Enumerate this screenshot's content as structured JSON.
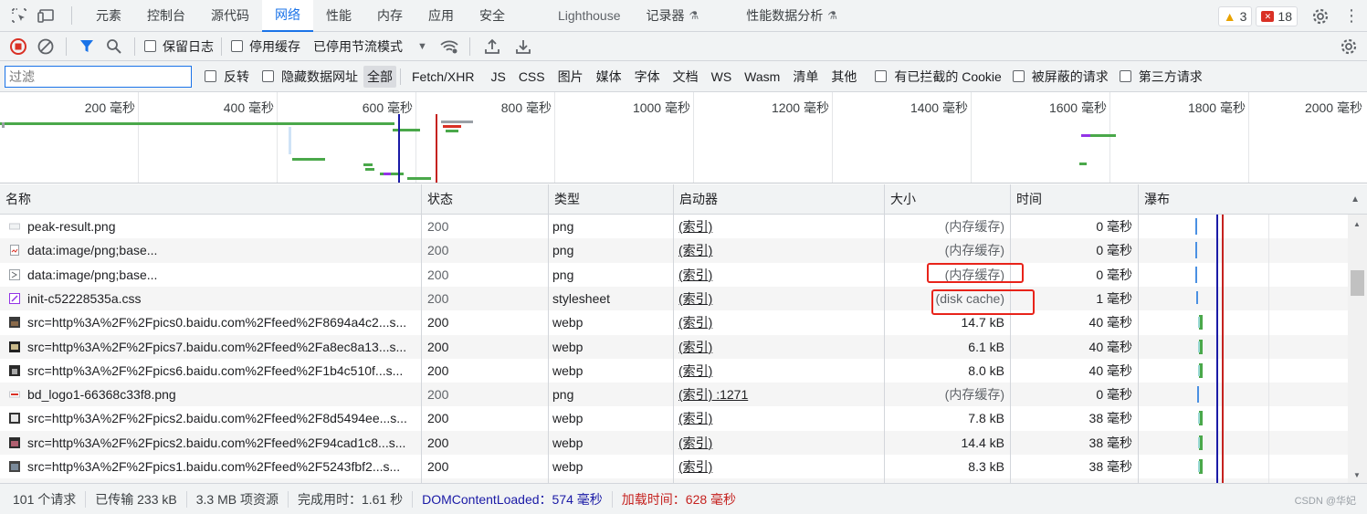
{
  "tabs": [
    {
      "label": "元素",
      "active": false
    },
    {
      "label": "控制台",
      "active": false
    },
    {
      "label": "源代码",
      "active": false
    },
    {
      "label": "网络",
      "active": true
    },
    {
      "label": "性能",
      "active": false
    },
    {
      "label": "内存",
      "active": false
    },
    {
      "label": "应用",
      "active": false
    },
    {
      "label": "安全",
      "active": false
    },
    {
      "label": "Lighthouse",
      "active": false
    },
    {
      "label": "记录器",
      "active": false,
      "experimental": true
    },
    {
      "label": "性能数据分析",
      "active": false,
      "experimental": true
    }
  ],
  "badges": {
    "warnings": "3",
    "errors": "18"
  },
  "toolbar": {
    "preserve_log": "保留日志",
    "disable_cache": "停用缓存",
    "throttling": "已停用节流模式"
  },
  "filter": {
    "placeholder": "过滤",
    "invert": "反转",
    "hide_data_urls": "隐藏数据网址",
    "types": [
      "全部",
      "Fetch/XHR",
      "JS",
      "CSS",
      "图片",
      "媒体",
      "字体",
      "文档",
      "WS",
      "Wasm",
      "清单",
      "其他"
    ],
    "blocked_cookies": "有已拦截的 Cookie",
    "blocked_requests": "被屏蔽的请求",
    "third_party": "第三方请求"
  },
  "overview": {
    "ticks": [
      "200 毫秒",
      "400 毫秒",
      "600 毫秒",
      "800 毫秒",
      "1000 毫秒",
      "1200 毫秒",
      "1400 毫秒",
      "1600 毫秒",
      "1800 毫秒",
      "2000 毫秒"
    ]
  },
  "columns": {
    "name": "名称",
    "status": "状态",
    "type": "类型",
    "initiator": "启动器",
    "size": "大小",
    "time": "时间",
    "waterfall": "瀑布"
  },
  "rows": [
    {
      "name": "peak-result.png",
      "status": "200",
      "type": "png",
      "initiator": "(索引)",
      "size": "(内存缓存)",
      "time": "0 毫秒",
      "icon": "image-file-icon"
    },
    {
      "name": "data:image/png;base...",
      "status": "200",
      "type": "png",
      "initiator": "(索引)",
      "size": "(内存缓存)",
      "time": "0 毫秒",
      "icon": "image-file-icon"
    },
    {
      "name": "data:image/png;base...",
      "status": "200",
      "type": "png",
      "initiator": "(索引)",
      "size": "(内存缓存)",
      "time": "0 毫秒",
      "icon": "image-file-icon"
    },
    {
      "name": "init-c52228535a.css",
      "status": "200",
      "type": "stylesheet",
      "initiator": "(索引)",
      "size": "(disk cache)",
      "time": "1 毫秒",
      "icon": "css-file-icon"
    },
    {
      "name": "src=http%3A%2F%2Fpics0.baidu.com%2Ffeed%2F8694a4c2...s...",
      "status": "200",
      "type": "webp",
      "initiator": "(索引)",
      "size": "14.7 kB",
      "time": "40 毫秒",
      "icon": "image-thumbnail-icon"
    },
    {
      "name": "src=http%3A%2F%2Fpics7.baidu.com%2Ffeed%2Fa8ec8a13...s...",
      "status": "200",
      "type": "webp",
      "initiator": "(索引)",
      "size": "6.1 kB",
      "time": "40 毫秒",
      "icon": "image-thumbnail-icon"
    },
    {
      "name": "src=http%3A%2F%2Fpics6.baidu.com%2Ffeed%2F1b4c510f...s...",
      "status": "200",
      "type": "webp",
      "initiator": "(索引)",
      "size": "8.0 kB",
      "time": "40 毫秒",
      "icon": "image-thumbnail-icon"
    },
    {
      "name": "bd_logo1-66368c33f8.png",
      "status": "200",
      "type": "png",
      "initiator": "(索引)  :1271",
      "size": "(内存缓存)",
      "time": "0 毫秒",
      "icon": "image-file-icon"
    },
    {
      "name": "src=http%3A%2F%2Fpics2.baidu.com%2Ffeed%2F8d5494ee...s...",
      "status": "200",
      "type": "webp",
      "initiator": "(索引)",
      "size": "7.8 kB",
      "time": "38 毫秒",
      "icon": "image-thumbnail-icon"
    },
    {
      "name": "src=http%3A%2F%2Fpics2.baidu.com%2Ffeed%2F94cad1c8...s...",
      "status": "200",
      "type": "webp",
      "initiator": "(索引)",
      "size": "14.4 kB",
      "time": "38 毫秒",
      "icon": "image-thumbnail-icon"
    },
    {
      "name": "src=http%3A%2F%2Fpics1.baidu.com%2Ffeed%2F5243fbf2...s...",
      "status": "200",
      "type": "webp",
      "initiator": "(索引)",
      "size": "8.3 kB",
      "time": "38 毫秒",
      "icon": "image-thumbnail-icon"
    }
  ],
  "statusbar": {
    "requests": "101 个请求",
    "transferred": "已传输 233 kB",
    "resources": "3.3 MB 项资源",
    "finish": "完成用时：1.61 秒",
    "dcl": "DOMContentLoaded：574 毫秒",
    "load": "加载时间：628 毫秒"
  },
  "watermark": "CSDN @华妃",
  "colors": {
    "accent": "#1a73e8",
    "highlight": "#e8231a",
    "dcl": "#1a1aa6",
    "load": "#c5221f"
  }
}
